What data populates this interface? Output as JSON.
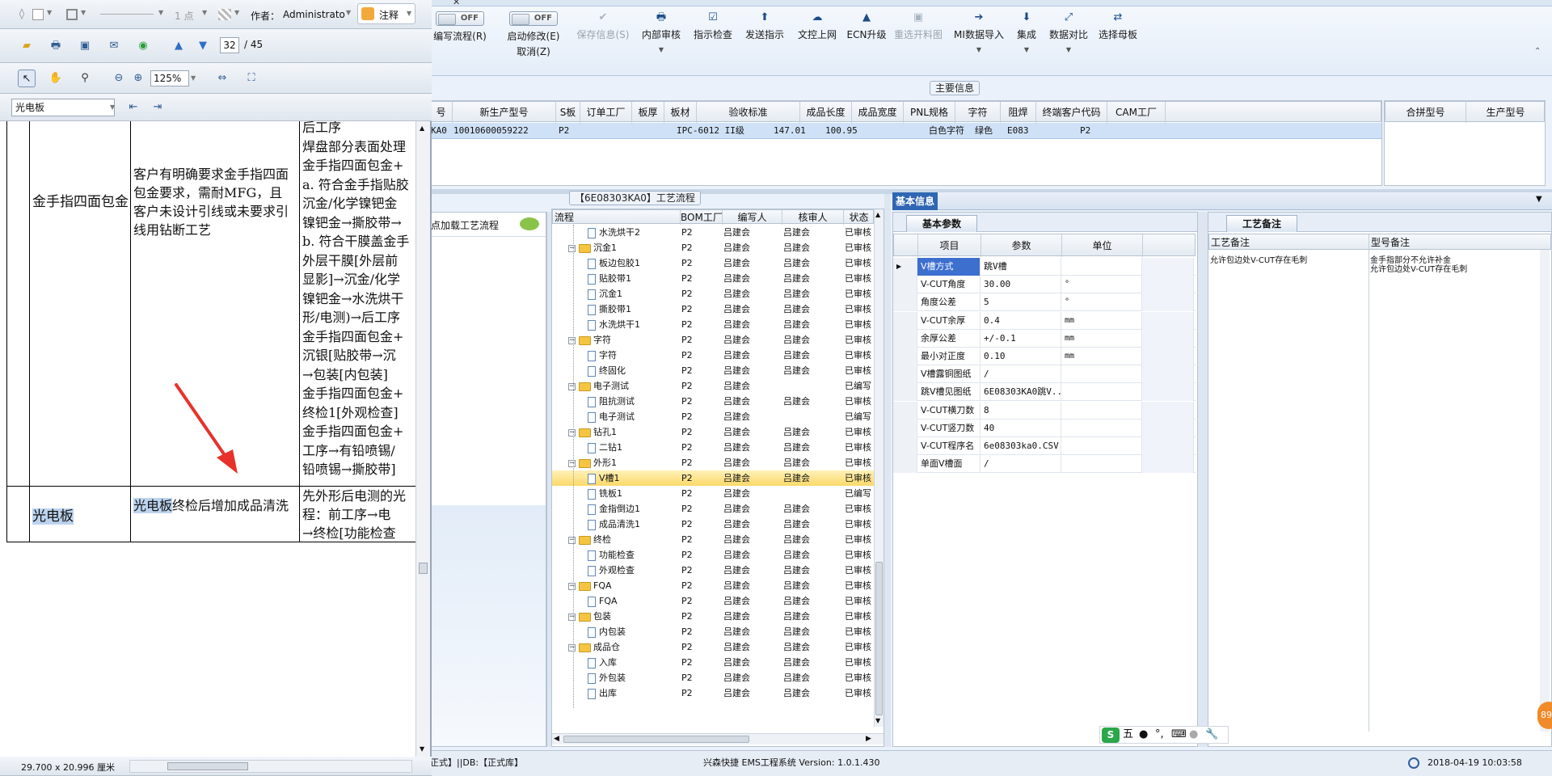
{
  "pdf": {
    "top_toolbar": {
      "dash": "1 点",
      "author_label": "作者：",
      "author_value": "Administrato",
      "annot_label": "注释"
    },
    "nav": {
      "page_current": "32",
      "page_total": "/ 45",
      "zoom": "125%"
    },
    "search_combo": "光电板",
    "doc": {
      "row1_title": "金手指四面包金",
      "row1_desc": "客户有明确要求金手指四面包金要求，需耐MFG，且客户未设计引线或未要求引线用钻断工艺",
      "row1_process_lines": [
        "后工序",
        "焊盘部分表面处理",
        "金手指四面包金+",
        "a. 符合金手指贴胶",
        "沉金/化学镍钯金",
        "镍钯金→撕胶带→",
        "b. 符合干膜盖金手",
        "外层干膜[外层前",
        "显影]→沉金/化学",
        "镍钯金→水洗烘干",
        "形/电测)→后工序",
        "金手指四面包金+",
        "沉银[贴胶带→沉",
        "→包装[内包装]",
        "金手指四面包金+",
        "终检1[外观检查]",
        "金手指四面包金+",
        "工序→有铅喷锡/",
        "铅喷锡→撕胶带]"
      ],
      "row2_title": "光电板",
      "row2_desc_hl": "光电板",
      "row2_desc_rest": "终检后增加成品清洗",
      "row2_process_lines": [
        "先外形后电测的光",
        "程：前工序→电",
        "→终检[功能检查"
      ]
    },
    "status": "29.700 x 20.996 厘米"
  },
  "toolbar": {
    "toggle_off": "OFF",
    "items": [
      {
        "label": "编写流程(R)",
        "icon": "toggle",
        "enabled": true
      },
      {
        "label": "启动修改(E)",
        "label2": "取消(Z)",
        "icon": "toggle",
        "enabled": true
      },
      {
        "label": "保存信息(S)",
        "icon": "✔",
        "enabled": false
      },
      {
        "label": "内部审核",
        "icon": "🖶",
        "enabled": true,
        "dropdown": true
      },
      {
        "label": "指示检查",
        "icon": "☑",
        "enabled": true
      },
      {
        "label": "发送指示",
        "icon": "⬆",
        "enabled": true
      },
      {
        "label": "文控上网",
        "icon": "☁",
        "enabled": true
      },
      {
        "label": "ECN升级",
        "icon": "▲",
        "enabled": true
      },
      {
        "label": "重选开料图",
        "icon": "▣",
        "enabled": false
      },
      {
        "label": "MI数据导入",
        "icon": "➔",
        "enabled": true,
        "dropdown": true
      },
      {
        "label": "集成",
        "icon": "⬇",
        "enabled": true,
        "dropdown": true
      },
      {
        "label": "数据对比",
        "icon": "⤢",
        "enabled": true,
        "dropdown": true
      },
      {
        "label": "选择母板",
        "icon": "⇄",
        "enabled": true
      }
    ]
  },
  "main_info": {
    "title": "主要信息",
    "columns": [
      "号",
      "新生产型号",
      "S板",
      "订单工厂",
      "板厚",
      "板材",
      "验收标准",
      "成品长度",
      "成品宽度",
      "PNL规格",
      "字符",
      "阻焊",
      "终端客户代码",
      "CAM工厂"
    ],
    "row": [
      "KA0",
      "10010600059222",
      "",
      "P2",
      "",
      "",
      "IPC-6012 II级",
      "147.01",
      "100.95",
      "",
      "白色字符",
      "绿色",
      "E083",
      "P2"
    ],
    "side_columns": [
      "合拼型号",
      "生产型号"
    ]
  },
  "flow": {
    "title": "【6E08303KA0】工艺流程",
    "left_link": "点加载工艺流程",
    "columns": [
      "流程",
      "BOM工厂",
      "编写人",
      "核审人",
      "状态"
    ],
    "rows": [
      {
        "name": "水洗烘干2",
        "level": 1,
        "bom": "P2",
        "writer": "吕建会",
        "checker": "吕建会",
        "status": "已审核"
      },
      {
        "name": "沉金1",
        "level": 0,
        "bom": "P2",
        "writer": "吕建会",
        "checker": "吕建会",
        "status": "已审核"
      },
      {
        "name": "板边包胶1",
        "level": 1,
        "bom": "P2",
        "writer": "吕建会",
        "checker": "吕建会",
        "status": "已审核"
      },
      {
        "name": "贴胶带1",
        "level": 1,
        "bom": "P2",
        "writer": "吕建会",
        "checker": "吕建会",
        "status": "已审核"
      },
      {
        "name": "沉金1",
        "level": 1,
        "bom": "P2",
        "writer": "吕建会",
        "checker": "吕建会",
        "status": "已审核"
      },
      {
        "name": "撕胶带1",
        "level": 1,
        "bom": "P2",
        "writer": "吕建会",
        "checker": "吕建会",
        "status": "已审核"
      },
      {
        "name": "水洗烘干1",
        "level": 1,
        "bom": "P2",
        "writer": "吕建会",
        "checker": "吕建会",
        "status": "已审核"
      },
      {
        "name": "字符",
        "level": 0,
        "bom": "P2",
        "writer": "吕建会",
        "checker": "吕建会",
        "status": "已审核"
      },
      {
        "name": "字符",
        "level": 1,
        "bom": "P2",
        "writer": "吕建会",
        "checker": "吕建会",
        "status": "已审核"
      },
      {
        "name": "终固化",
        "level": 1,
        "bom": "P2",
        "writer": "吕建会",
        "checker": "吕建会",
        "status": "已审核"
      },
      {
        "name": "电子测试",
        "level": 0,
        "bom": "P2",
        "writer": "吕建会",
        "checker": "",
        "status": "已编写"
      },
      {
        "name": "阻抗测试",
        "level": 1,
        "bom": "P2",
        "writer": "吕建会",
        "checker": "吕建会",
        "status": "已审核"
      },
      {
        "name": "电子测试",
        "level": 1,
        "bom": "P2",
        "writer": "吕建会",
        "checker": "",
        "status": "已编写"
      },
      {
        "name": "钻孔1",
        "level": 0,
        "bom": "P2",
        "writer": "吕建会",
        "checker": "吕建会",
        "status": "已审核"
      },
      {
        "name": "二钻1",
        "level": 1,
        "bom": "P2",
        "writer": "吕建会",
        "checker": "吕建会",
        "status": "已审核"
      },
      {
        "name": "外形1",
        "level": 0,
        "bom": "P2",
        "writer": "吕建会",
        "checker": "吕建会",
        "status": "已审核"
      },
      {
        "name": "V槽1",
        "level": 1,
        "bom": "P2",
        "writer": "吕建会",
        "checker": "吕建会",
        "status": "已审核",
        "selected": true
      },
      {
        "name": "铣板1",
        "level": 1,
        "bom": "P2",
        "writer": "吕建会",
        "checker": "",
        "status": "已编写"
      },
      {
        "name": "金指倒边1",
        "level": 1,
        "bom": "P2",
        "writer": "吕建会",
        "checker": "吕建会",
        "status": "已审核"
      },
      {
        "name": "成品清洗1",
        "level": 1,
        "bom": "P2",
        "writer": "吕建会",
        "checker": "吕建会",
        "status": "已审核"
      },
      {
        "name": "终检",
        "level": 0,
        "bom": "P2",
        "writer": "吕建会",
        "checker": "吕建会",
        "status": "已审核"
      },
      {
        "name": "功能检查",
        "level": 1,
        "bom": "P2",
        "writer": "吕建会",
        "checker": "吕建会",
        "status": "已审核"
      },
      {
        "name": "外观检查",
        "level": 1,
        "bom": "P2",
        "writer": "吕建会",
        "checker": "吕建会",
        "status": "已审核"
      },
      {
        "name": "FQA",
        "level": 0,
        "bom": "P2",
        "writer": "吕建会",
        "checker": "吕建会",
        "status": "已审核"
      },
      {
        "name": "FQA",
        "level": 1,
        "bom": "P2",
        "writer": "吕建会",
        "checker": "吕建会",
        "status": "已审核"
      },
      {
        "name": "包装",
        "level": 0,
        "bom": "P2",
        "writer": "吕建会",
        "checker": "吕建会",
        "status": "已审核"
      },
      {
        "name": "内包装",
        "level": 1,
        "bom": "P2",
        "writer": "吕建会",
        "checker": "吕建会",
        "status": "已审核"
      },
      {
        "name": "成品仓",
        "level": 0,
        "bom": "P2",
        "writer": "吕建会",
        "checker": "吕建会",
        "status": "已审核"
      },
      {
        "name": "入库",
        "level": 1,
        "bom": "P2",
        "writer": "吕建会",
        "checker": "吕建会",
        "status": "已审核"
      },
      {
        "name": "外包装",
        "level": 1,
        "bom": "P2",
        "writer": "吕建会",
        "checker": "吕建会",
        "status": "已审核"
      },
      {
        "name": "出库",
        "level": 1,
        "bom": "P2",
        "writer": "吕建会",
        "checker": "吕建会",
        "status": "已审核"
      }
    ]
  },
  "basic_info": {
    "title": "基本信息",
    "tab": "基本参数",
    "columns": [
      "项目",
      "参数",
      "单位"
    ],
    "rows": [
      {
        "item": "V槽方式",
        "value": "跳V槽",
        "unit": "",
        "selected": true
      },
      {
        "item": "V-CUT角度",
        "value": "30.00",
        "unit": "°"
      },
      {
        "item": "角度公差",
        "value": "5",
        "unit": "°"
      },
      {
        "item": "V-CUT余厚",
        "value": "0.4",
        "unit": "mm"
      },
      {
        "item": "余厚公差",
        "value": "+/-0.1",
        "unit": "mm"
      },
      {
        "item": "最小对正度",
        "value": "0.10",
        "unit": "mm"
      },
      {
        "item": "V槽露铜图纸",
        "value": "/",
        "unit": ""
      },
      {
        "item": "跳V槽见图纸",
        "value": "6E08303KA0跳V...",
        "unit": ""
      },
      {
        "item": "V-CUT横刀数",
        "value": "8",
        "unit": ""
      },
      {
        "item": "V-CUT竖刀数",
        "value": "40",
        "unit": ""
      },
      {
        "item": "V-CUT程序名",
        "value": "6e08303ka0.CSV",
        "unit": ""
      },
      {
        "item": "单面V槽面",
        "value": "/",
        "unit": ""
      }
    ]
  },
  "remarks": {
    "tab": "工艺备注",
    "col1": "工艺备注",
    "col2": "型号备注",
    "col1_text": "允许包边处V-CUT存在毛刺",
    "col2_line1": "金手指部分不允许补金",
    "col2_line2": "允许包边处V-CUT存在毛刺"
  },
  "ime": {
    "label": "五"
  },
  "statusbar": {
    "left": "正式】||DB:【正式库】",
    "center": "兴森快捷 EMS工程系统 Version: 1.0.1.430",
    "datetime": "2018-04-19 10:03:58",
    "badge": "89"
  },
  "colors": {
    "accent": "#3d6fcf",
    "selected_row": "#fbd96a",
    "folder": "#f5c542",
    "annotation_arrow": "#e8312a"
  }
}
